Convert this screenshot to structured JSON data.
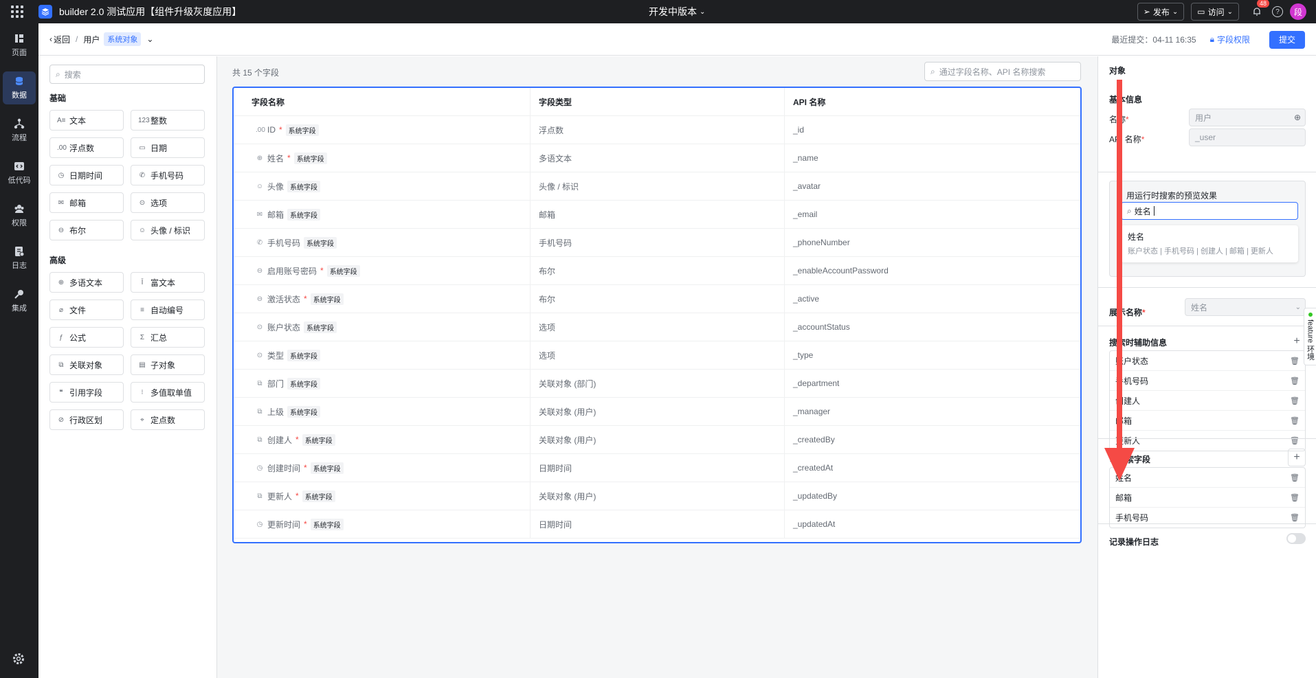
{
  "topbar": {
    "app_title": "builder 2.0 测试应用【组件升级灰度应用】",
    "version": "开发中版本",
    "publish": "发布",
    "visit": "访问",
    "notif_count": "48",
    "help": "?",
    "avatar": "段"
  },
  "nav": {
    "items": [
      {
        "label": "页面",
        "icon": "pages-icon"
      },
      {
        "label": "数据",
        "icon": "database-icon"
      },
      {
        "label": "流程",
        "icon": "flow-icon"
      },
      {
        "label": "低代码",
        "icon": "code-icon"
      },
      {
        "label": "权限",
        "icon": "permission-icon"
      },
      {
        "label": "日志",
        "icon": "log-icon"
      },
      {
        "label": "集成",
        "icon": "integration-icon"
      }
    ]
  },
  "subheader": {
    "back": "返回",
    "separator": "/",
    "object": "用户",
    "tag": "系统对象",
    "recent": "最近提交：04-11 16:35",
    "field_perm": "字段权限",
    "submit": "提交"
  },
  "palette": {
    "search_placeholder": "搜索",
    "basic_title": "基础",
    "basic": [
      {
        "icon": "A≡",
        "label": "文本"
      },
      {
        "icon": "123",
        "label": "整数"
      },
      {
        "icon": ".00",
        "label": "浮点数"
      },
      {
        "icon": "▭",
        "label": "日期"
      },
      {
        "icon": "◷",
        "label": "日期时间"
      },
      {
        "icon": "✆",
        "label": "手机号码"
      },
      {
        "icon": "✉",
        "label": "邮箱"
      },
      {
        "icon": "⊙",
        "label": "选项"
      },
      {
        "icon": "⊖",
        "label": "布尔"
      },
      {
        "icon": "☺",
        "label": "头像 / 标识"
      }
    ],
    "advanced_title": "高级",
    "advanced": [
      {
        "icon": "⊕",
        "label": "多语文本"
      },
      {
        "icon": "Ī",
        "label": "富文本"
      },
      {
        "icon": "⌀",
        "label": "文件"
      },
      {
        "icon": "≡",
        "label": "自动编号"
      },
      {
        "icon": "ƒ",
        "label": "公式"
      },
      {
        "icon": "Σ",
        "label": "汇总"
      },
      {
        "icon": "⧉",
        "label": "关联对象"
      },
      {
        "icon": "▤",
        "label": "子对象"
      },
      {
        "icon": "❝",
        "label": "引用字段"
      },
      {
        "icon": "⁝",
        "label": "多值取单值"
      },
      {
        "icon": "⊘",
        "label": "行政区划"
      },
      {
        "icon": "⌖",
        "label": "定点数"
      }
    ]
  },
  "table": {
    "count": "共 15 个字段",
    "search_placeholder": "通过字段名称、API 名称搜索",
    "headers": [
      "字段名称",
      "字段类型",
      "API 名称"
    ],
    "rows": [
      {
        "icon": ".00",
        "name": "ID",
        "req": "*",
        "tag": "系统字段",
        "type": "浮点数",
        "api": "_id"
      },
      {
        "icon": "⊕",
        "name": "姓名",
        "req": "*",
        "tag": "系统字段",
        "type": "多语文本",
        "api": "_name"
      },
      {
        "icon": "☺",
        "name": "头像",
        "req": "",
        "tag": "系统字段",
        "type": "头像 / 标识",
        "api": "_avatar"
      },
      {
        "icon": "✉",
        "name": "邮箱",
        "req": "",
        "tag": "系统字段",
        "type": "邮箱",
        "api": "_email"
      },
      {
        "icon": "✆",
        "name": "手机号码",
        "req": "",
        "tag": "系统字段",
        "type": "手机号码",
        "api": "_phoneNumber"
      },
      {
        "icon": "⊖",
        "name": "启用账号密码",
        "req": "*",
        "tag": "系统字段",
        "type": "布尔",
        "api": "_enableAccountPassword"
      },
      {
        "icon": "⊖",
        "name": "激活状态",
        "req": "*",
        "tag": "系统字段",
        "type": "布尔",
        "api": "_active"
      },
      {
        "icon": "⊙",
        "name": "账户状态",
        "req": "",
        "tag": "系统字段",
        "type": "选项",
        "api": "_accountStatus"
      },
      {
        "icon": "⊙",
        "name": "类型",
        "req": "",
        "tag": "系统字段",
        "type": "选项",
        "api": "_type"
      },
      {
        "icon": "⧉",
        "name": "部门",
        "req": "",
        "tag": "系统字段",
        "type": "关联对象 (部门)",
        "api": "_department"
      },
      {
        "icon": "⧉",
        "name": "上级",
        "req": "",
        "tag": "系统字段",
        "type": "关联对象 (用户)",
        "api": "_manager"
      },
      {
        "icon": "⧉",
        "name": "创建人",
        "req": "*",
        "tag": "系统字段",
        "type": "关联对象 (用户)",
        "api": "_createdBy"
      },
      {
        "icon": "◷",
        "name": "创建时间",
        "req": "*",
        "tag": "系统字段",
        "type": "日期时间",
        "api": "_createdAt"
      },
      {
        "icon": "⧉",
        "name": "更新人",
        "req": "*",
        "tag": "系统字段",
        "type": "关联对象 (用户)",
        "api": "_updatedBy"
      },
      {
        "icon": "◷",
        "name": "更新时间",
        "req": "*",
        "tag": "系统字段",
        "type": "日期时间",
        "api": "_updatedAt"
      }
    ]
  },
  "right": {
    "title": "对象",
    "basic_title": "基本信息",
    "name_label": "名称",
    "name_value": "用户",
    "api_label": "API 名称",
    "api_value": "_user",
    "required_mark": "*",
    "preview_label": "用运行时搜索的预览效果",
    "preview_input": "姓名",
    "preview_result_title": "姓名",
    "preview_result_sub": "账户状态 | 手机号码 | 创建人 | 邮箱 | 更新人",
    "display_label": "展示名称",
    "display_value": "姓名",
    "aux_title": "搜索时辅助信息",
    "aux_items": [
      "账户状态",
      "手机号码",
      "创建人",
      "邮箱",
      "更新人"
    ],
    "searchable_title": "可搜索字段",
    "searchable_items": [
      "姓名",
      "邮箱",
      "手机号码"
    ],
    "log_label": "记录操作日志",
    "log_enabled": false
  },
  "feature_tab": "feature 环境",
  "colors": {
    "accent": "#3370ff",
    "arrow": "#f54a45",
    "danger": "#f54a45",
    "nav_bg": "#1e1f22"
  }
}
